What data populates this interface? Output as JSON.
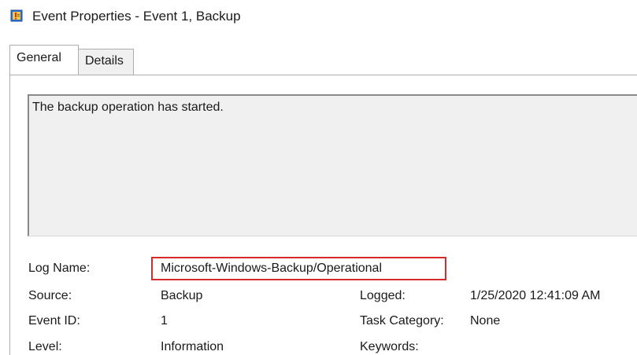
{
  "window": {
    "title": "Event Properties - Event 1, Backup",
    "icon": "event-viewer-icon"
  },
  "tabs": [
    {
      "label": "General",
      "selected": true
    },
    {
      "label": "Details",
      "selected": false
    }
  ],
  "general": {
    "description": "The backup operation has started.",
    "fields": {
      "log_name": {
        "label": "Log Name:",
        "value": "Microsoft-Windows-Backup/Operational"
      },
      "source": {
        "label": "Source:",
        "value": "Backup"
      },
      "logged": {
        "label": "Logged:",
        "value": "1/25/2020 12:41:09 AM"
      },
      "event_id": {
        "label": "Event ID:",
        "value": "1"
      },
      "task_category": {
        "label": "Task Category:",
        "value": "None"
      },
      "level": {
        "label": "Level:",
        "value": "Information"
      },
      "keywords": {
        "label": "Keywords:",
        "value": ""
      }
    }
  },
  "colors": {
    "highlight_border": "#d62b2b",
    "panel_border": "#adadad"
  }
}
